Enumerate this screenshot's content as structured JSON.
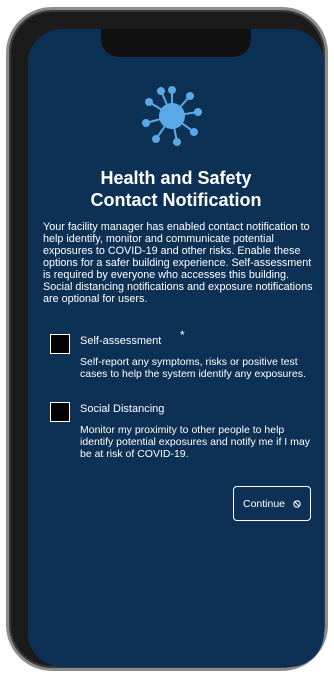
{
  "screen": {
    "icon": "virus-icon",
    "background_color": "#0d3155",
    "accent_color": "#5aa9e6",
    "title_line1": "Health and Safety",
    "title_line2": "Contact Notification",
    "description": "Your facility manager has enabled contact notification to help identify, monitor and communicate potential exposures to COVID-19 and other risks. Enable these options for a safer building experience. Self-assessment is required by everyone who accesses this building. Social distancing notifications and exposure notifications are optional for users.",
    "options": [
      {
        "label": "Self-assessment",
        "required_marker": "*",
        "checked": false,
        "description": "Self-report any symptoms, risks or positive test cases to help the system identify any exposures."
      },
      {
        "label": "Social Distancing",
        "checked": false,
        "description": "Monitor my proximity to other people to help identify potential exposures and notify me if I may be at risk of COVID-19."
      }
    ],
    "continue_label": "Continue",
    "continue_icon": "disabled-icon"
  }
}
